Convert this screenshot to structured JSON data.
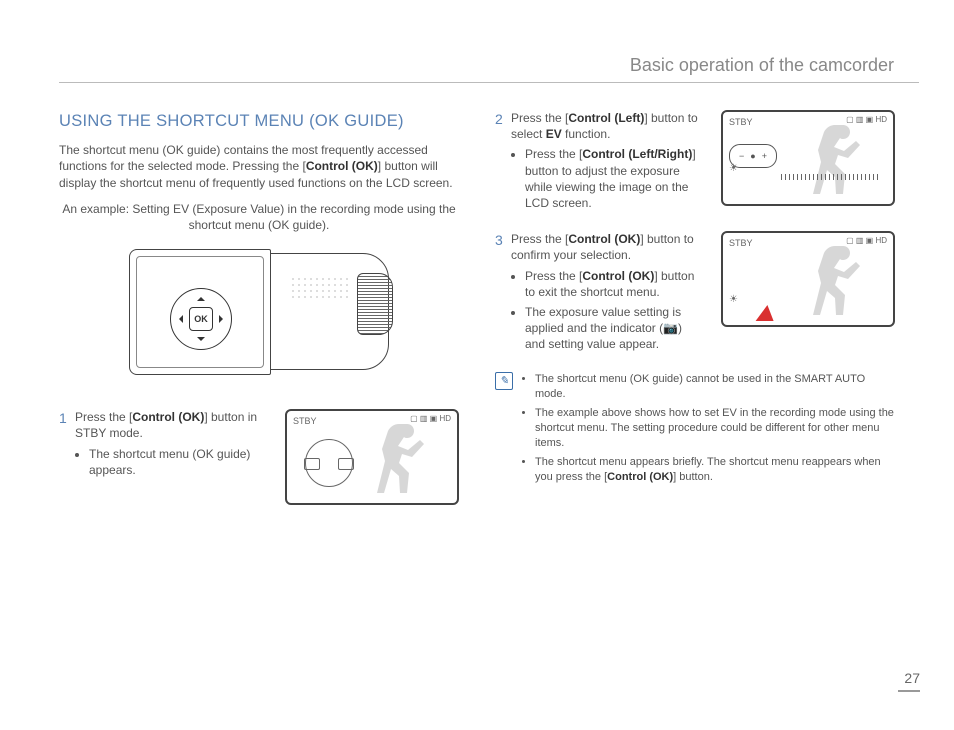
{
  "header": {
    "title": "Basic operation of the camcorder"
  },
  "page_number": "27",
  "left": {
    "section_title": "USING THE SHORTCUT MENU (OK GUIDE)",
    "intro_a": "The shortcut menu (OK guide) contains the most frequently accessed functions for the selected mode. Pressing the [",
    "intro_b": "Control (OK)",
    "intro_c": "] button will display the shortcut menu of frequently used functions on the LCD screen.",
    "example": "An example: Setting EV (Exposure Value) in the recording mode using the shortcut menu (OK guide).",
    "ok_label": "OK",
    "step1_num": "1",
    "step1_a": "Press the [",
    "step1_b": "Control (OK)",
    "step1_c": "] button in STBY mode.",
    "step1_bullet": "The shortcut menu (OK guide) appears."
  },
  "right": {
    "step2_num": "2",
    "step2_a": "Press the [",
    "step2_b": "Control (Left)",
    "step2_c": "] button to select ",
    "step2_d": "EV",
    "step2_e": " function.",
    "step2_b1a": "Press the [",
    "step2_b1b": "Control (Left/Right)",
    "step2_b1c": "] button to adjust the exposure while viewing the image on the LCD screen.",
    "step3_num": "3",
    "step3_a": "Press the [",
    "step3_b": "Control (OK)",
    "step3_c": "] button to confirm your selection.",
    "step3_b1a": "Press the [",
    "step3_b1b": "Control (OK)",
    "step3_b1c": "] button to exit the shortcut menu.",
    "step3_b2": "The exposure value setting is applied and the indicator (📷) and setting value appear.",
    "note1": "The shortcut menu (OK guide) cannot be used in the SMART AUTO mode.",
    "note2": "The example above shows how to set EV in the recording mode using the shortcut menu. The setting procedure could be different for other menu items.",
    "note3a": "The shortcut menu appears briefly. The shortcut menu reappears when you press the [",
    "note3b": "Control (OK)",
    "note3c": "] button."
  },
  "lcd": {
    "stby": "STBY",
    "top_right": "▢ ▥\n▣ HD",
    "ev_minus": "−",
    "ev_dot": "●",
    "ev_plus": "+",
    "ev_icon": "☀"
  }
}
